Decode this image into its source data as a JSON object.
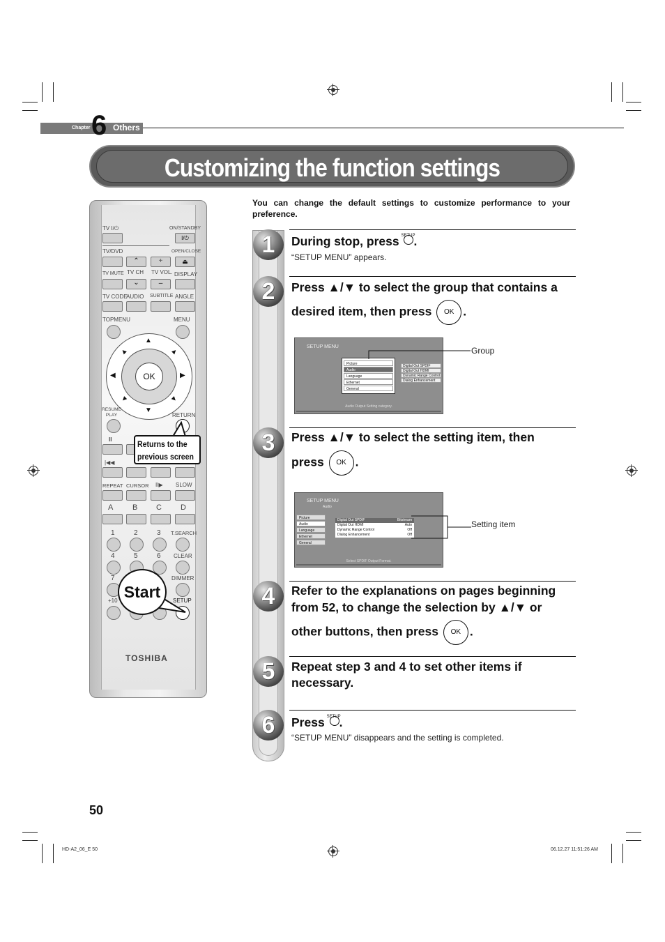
{
  "chapter": {
    "label": "Chapter",
    "number": "6",
    "title": "Others"
  },
  "page_title": "Customizing the function settings",
  "intro": "You can change the default settings to customize performance to your preference.",
  "remote": {
    "labels": {
      "tv_power": "TV I/⏻",
      "on_standby": "ON/STANDBY",
      "power_symbol": "I/⏻",
      "tv_dvd": "TV/DVD",
      "open_close": "OPEN/CLOSE",
      "tv_mute": "TV MUTE",
      "tv_ch": "TV CH",
      "tv_vol": "TV VOL.",
      "display": "DISPLAY",
      "tv_code": "TV CODE",
      "audio": "AUDIO",
      "subtitle": "SUBTITLE",
      "angle": "ANGLE",
      "top_menu": "TOPMENU",
      "menu": "MENU",
      "ok": "OK",
      "resume_play": "RESUME PLAY",
      "return": "RETURN",
      "repeat": "REPEAT",
      "cursor": "CURSOR",
      "slow": "SLOW",
      "a": "A",
      "b": "B",
      "c": "C",
      "d": "D",
      "n1": "1",
      "n2": "2",
      "n3": "3",
      "t_search": "T.SEARCH",
      "n4": "4",
      "n5": "5",
      "n6": "6",
      "clear": "CLEAR",
      "n7": "7",
      "dimmer": "DIMMER",
      "plus10": "+10",
      "setup": "SETUP",
      "brand": "TOSHIBA"
    },
    "callout_return": [
      "Returns to the",
      "previous screen"
    ],
    "callout_start": "Start"
  },
  "steps": [
    {
      "number": "1",
      "heading": "During stop, press",
      "button": "SETUP",
      "sub": "“SETUP MENU” appears."
    },
    {
      "number": "2",
      "heading_line1": "Press ▲/▼ to select the group that contains a",
      "heading_line2": "desired item, then press",
      "button": "OK"
    },
    {
      "number": "3",
      "heading_line1": "Press ▲/▼ to select the setting item, then",
      "heading_line2": "press",
      "button": "OK"
    },
    {
      "number": "4",
      "heading_line1": "Refer to the explanations on pages beginning",
      "heading_line2": "from 52, to change the selection by ▲/▼ or",
      "heading_line3": "other buttons, then press",
      "button": "OK"
    },
    {
      "number": "5",
      "heading_line1": "Repeat step 3 and 4 to set other items if",
      "heading_line2": "necessary."
    },
    {
      "number": "6",
      "heading": "Press",
      "button": "SETUP",
      "sub": "“SETUP MENU” disappears and the setting is completed."
    }
  ],
  "screen1": {
    "title": "SETUP MENU",
    "groups": [
      "Picture",
      "Audio",
      "Language",
      "Ethernet",
      "General"
    ],
    "selected_group": "Audio",
    "sub_items": [
      "Digital Out SPDIF",
      "Digital Out HDMI",
      "Dynamic Range Control",
      "Dialog Enhancement"
    ],
    "footer": "Audio Output Setting category.",
    "annotation": "Group"
  },
  "screen2": {
    "title": "SETUP MENU",
    "breadcrumb": "Audio",
    "groups": [
      "Picture",
      "Audio",
      "Language",
      "Ethernet",
      "General"
    ],
    "settings": [
      {
        "name": "Digital Out SPDIF",
        "value": "Bitstream"
      },
      {
        "name": "Digital Out HDMI",
        "value": "Auto"
      },
      {
        "name": "Dynamic Range Control",
        "value": "Off"
      },
      {
        "name": "Dialog Enhancement",
        "value": "Off"
      }
    ],
    "footer": "Select SPDIF Output Format.",
    "annotation": "Setting item"
  },
  "page_number": "50",
  "footer": {
    "left": "HD-A2_06_E  50",
    "right": "06.12.27   11:51:26 AM"
  }
}
